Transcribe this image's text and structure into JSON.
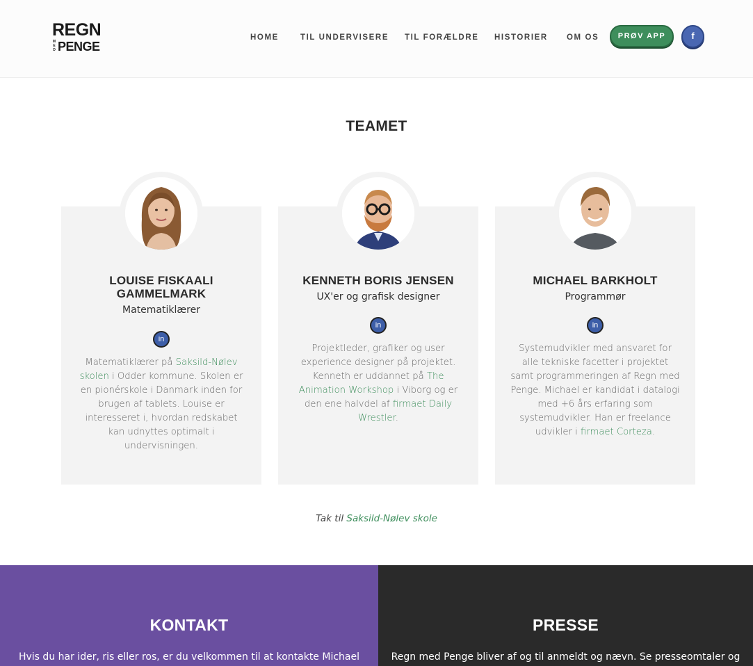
{
  "logo": {
    "top": "REGN",
    "med": "MED",
    "bottom": "PENGE"
  },
  "nav": {
    "items": [
      "HOME",
      "TIL UNDERVISERE",
      "TIL FORÆLDRE",
      "HISTORIER",
      "OM OS"
    ],
    "app_button": "PRØV APP",
    "facebook_label": "f"
  },
  "team": {
    "title": "TEAMET",
    "members": [
      {
        "name": "LOUISE FISKAALI GAMMELMARK",
        "role": "Matematiklærer",
        "linkedin": "in",
        "bio": {
          "pre": "Matematiklærer på ",
          "link1": "Saksild-Nølev skolen",
          "mid": " i Odder kommune. Skolen er en pionérskole i Danmark inden for brugen af tablets. Louise er interesseret i, hvordan redskabet kan udnyttes optimalt i undervisningen."
        }
      },
      {
        "name": "KENNETH BORIS JENSEN",
        "role": "UX'er og grafisk designer",
        "linkedin": "in",
        "bio": {
          "pre": "Projektleder, grafiker og user experience designer på projektet. Kenneth er uddannet på ",
          "link1": "The Animation Workshop",
          "mid": " i Viborg og er den ene halvdel af ",
          "link2": "firmaet Daily Wrestler",
          "post": "."
        }
      },
      {
        "name": "MICHAEL BARKHOLT",
        "role": "Programmør",
        "linkedin": "in",
        "bio": {
          "pre": "Systemudvikler med ansvaret for alle tekniske facetter i projektet samt programmeringen af Regn med Penge. Michael er kandidat i datalogi med +6 års erfaring som systemudvikler. Han er freelance udvikler i ",
          "link1": "firmaet Corteza",
          "post": "."
        }
      }
    ],
    "thanks_pre": "Tak til ",
    "thanks_link": "Saksild-Nølev skole"
  },
  "contact": {
    "title": "KONTAKT",
    "text": "Hvis du har ider, ris eller ros, er du velkommen til at kontakte Michael"
  },
  "press": {
    "title": "PRESSE",
    "text": "Regn med Penge bliver af og til anmeldt og nævn. Se presseomtaler og"
  },
  "colors": {
    "accent_green": "#3e8e5c",
    "contact_bg": "#6a4fa0",
    "press_bg": "#2a2a2a",
    "facebook_blue": "#4a67b2"
  }
}
